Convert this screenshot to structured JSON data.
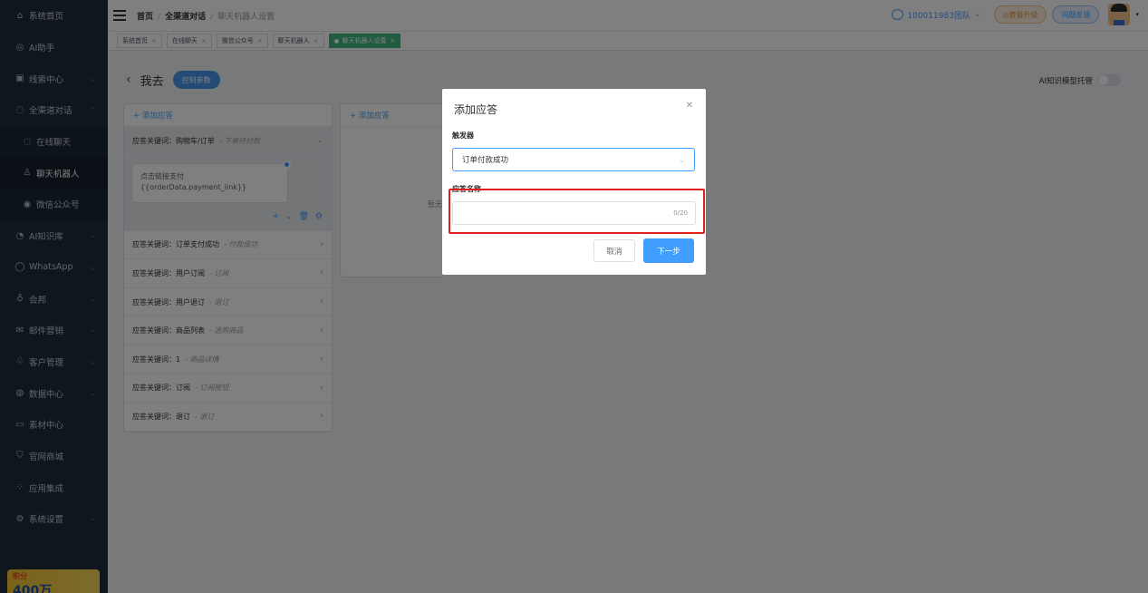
{
  "sidebar": {
    "items": [
      {
        "icon": "home-icon",
        "glyph": "⌂",
        "label": "系统首页",
        "chevron": ""
      },
      {
        "icon": "ai-assistant-icon",
        "glyph": "◎",
        "label": "AI助手",
        "chevron": ""
      },
      {
        "icon": "leads-icon",
        "glyph": "▣",
        "label": "线索中心",
        "chevron": "⌄"
      },
      {
        "icon": "chat-icon",
        "glyph": "◌",
        "label": "全渠道对话",
        "chevron": "⌃"
      }
    ],
    "sub_items": [
      {
        "icon": "online-chat-icon",
        "glyph": "◌",
        "label": "在线聊天"
      },
      {
        "icon": "robot-icon",
        "glyph": "♙",
        "label": "聊天机器人"
      },
      {
        "icon": "wechat-icon",
        "glyph": "◉",
        "label": "微信公众号"
      }
    ],
    "items2": [
      {
        "icon": "knowledge-icon",
        "glyph": "◔",
        "label": "AI知识库",
        "chevron": "⌄"
      },
      {
        "icon": "whatsapp-icon",
        "glyph": "◯",
        "label": "WhatsApp",
        "chevron": "⌄"
      },
      {
        "icon": "bulb-icon",
        "glyph": "♁",
        "label": "会邦",
        "chevron": "⌄"
      },
      {
        "icon": "mail-icon",
        "glyph": "✉",
        "label": "邮件营销",
        "chevron": "⌄"
      },
      {
        "icon": "customers-icon",
        "glyph": "♧",
        "label": "客户管理",
        "chevron": "⌄"
      },
      {
        "icon": "data-icon",
        "glyph": "◍",
        "label": "数据中心",
        "chevron": "⌄"
      },
      {
        "icon": "folder-icon",
        "glyph": "▭",
        "label": "素材中心",
        "chevron": ""
      },
      {
        "icon": "cart-icon",
        "glyph": "⛉",
        "label": "官网商城",
        "chevron": ""
      },
      {
        "icon": "apps-icon",
        "glyph": "⁘",
        "label": "应用集成",
        "chevron": ""
      },
      {
        "icon": "settings-icon",
        "glyph": "⚙",
        "label": "系统设置",
        "chevron": "⌄"
      }
    ],
    "promo": {
      "line1": "积分",
      "line2": "400万"
    }
  },
  "topbar": {
    "breadcrumb": [
      "首页",
      "全渠道对话",
      "聊天机器人设置"
    ],
    "team": "100011983团队",
    "upgrade": "◎套餐升级",
    "feedback": "问题反馈"
  },
  "tabs": [
    {
      "label": "系统首页",
      "active": false
    },
    {
      "label": "在线聊天",
      "active": false
    },
    {
      "label": "微信公众号",
      "active": false
    },
    {
      "label": "聊天机器人",
      "active": false
    },
    {
      "label": "聊天机器人设置",
      "active": true
    }
  ],
  "content": {
    "back_name": "我去",
    "control_params": "控制参数",
    "ai_toggle_label": "AI知识模型托管",
    "add_response": "+ 添加应答",
    "rows": [
      {
        "kw": "应答关键词：购物车/订单",
        "sub": "- 下单待付款",
        "open": true
      },
      {
        "kw": "应答关键词：订单支付成功",
        "sub": "- 付款成功",
        "open": false
      },
      {
        "kw": "应答关键词：用户订阅",
        "sub": "- 订阅",
        "open": false
      },
      {
        "kw": "应答关键词：用户退订",
        "sub": "- 退订",
        "open": false
      },
      {
        "kw": "应答关键词：商品列表",
        "sub": "- 选购商品",
        "open": false
      },
      {
        "kw": "应答关键词：1",
        "sub": "- 商品详情",
        "open": false
      },
      {
        "kw": "应答关键词：订阅",
        "sub": "- 订阅按钮",
        "open": false
      },
      {
        "kw": "应答关键词：退订",
        "sub": "- 退订",
        "open": false
      }
    ],
    "card_line1": "点击链接支付",
    "card_line2": "{{orderData.payment_link}}",
    "mid_add": "+ 添加应答",
    "mid_empty": "暂无"
  },
  "modal": {
    "title": "添加应答",
    "trigger_label": "触发器",
    "trigger_value": "订单付款成功",
    "name_label": "应答名称",
    "name_value": "",
    "name_counter": "0/20",
    "cancel": "取消",
    "next": "下一步"
  }
}
